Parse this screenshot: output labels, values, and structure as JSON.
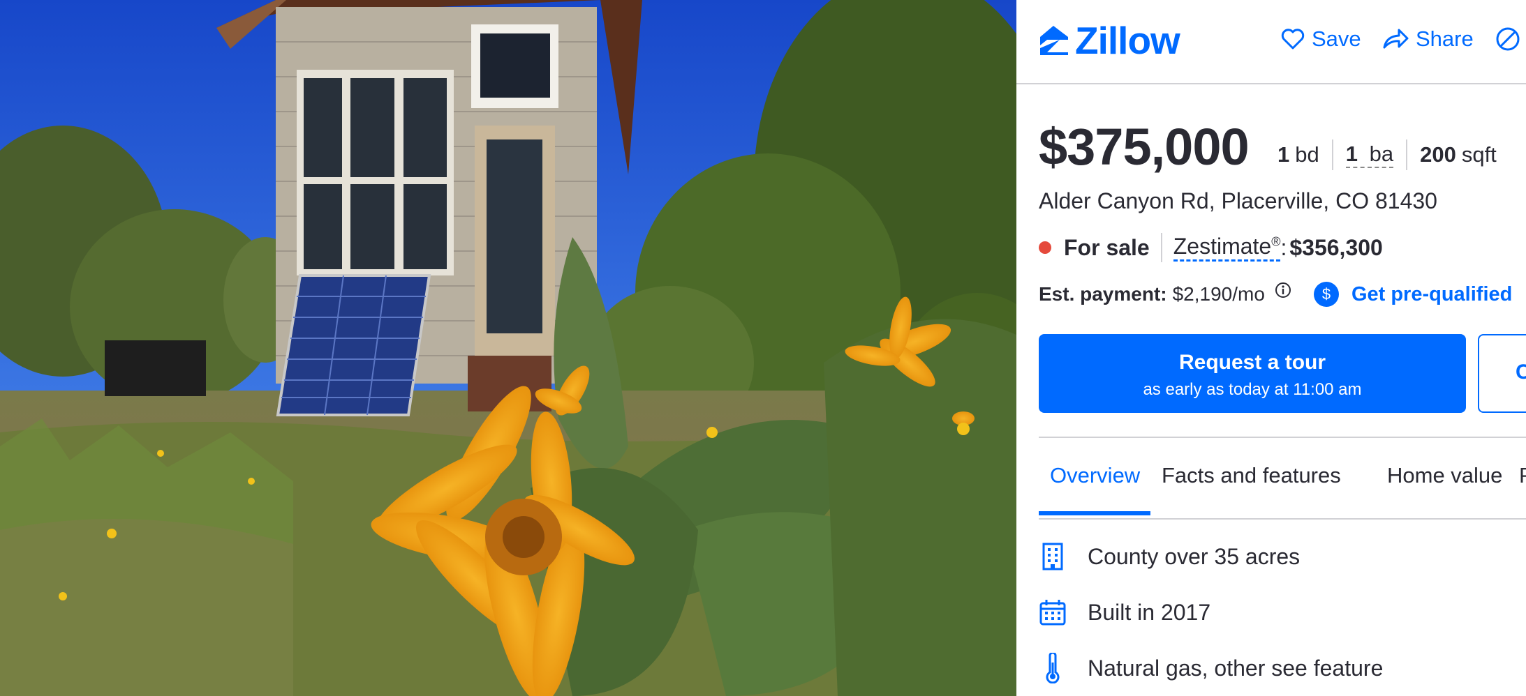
{
  "brand": {
    "name": "Zillow",
    "color": "#006aff"
  },
  "header": {
    "actions": [
      {
        "label": "Save",
        "icon": "heart-icon"
      },
      {
        "label": "Share",
        "icon": "share-icon"
      },
      {
        "label": "",
        "icon": "hide-icon"
      }
    ]
  },
  "listing": {
    "price": "$375,000",
    "beds": {
      "value": "1",
      "unit": "bd"
    },
    "baths": {
      "value": "1",
      "unit": "ba"
    },
    "sqft": {
      "value": "200",
      "unit": "sqft"
    },
    "address": "Alder Canyon Rd, Placerville, CO 81430",
    "status": "For sale",
    "status_color": "#e54a3c",
    "zestimate_label": "Zestimate",
    "zestimate_mark": "®",
    "zestimate_value": "$356,300",
    "payment_label": "Est. payment:",
    "payment_value": "$2,190/mo",
    "prequal_label": "Get pre-qualified",
    "prequal_badge": "$"
  },
  "cta": {
    "tour_title": "Request a tour",
    "tour_subtitle": "as early as today at 11:00 am",
    "contact_label": "C"
  },
  "tabs": [
    {
      "label": "Overview",
      "active": true
    },
    {
      "label": "Facts and features",
      "active": false
    },
    {
      "label": "Home value",
      "active": false
    },
    {
      "label": "Pr",
      "active": false
    }
  ],
  "features": [
    {
      "label": "County over 35 acres",
      "icon": "building-icon"
    },
    {
      "label": "Built in 2017",
      "icon": "calendar-icon"
    },
    {
      "label": "Natural gas, other see feature",
      "icon": "thermometer-icon"
    }
  ]
}
